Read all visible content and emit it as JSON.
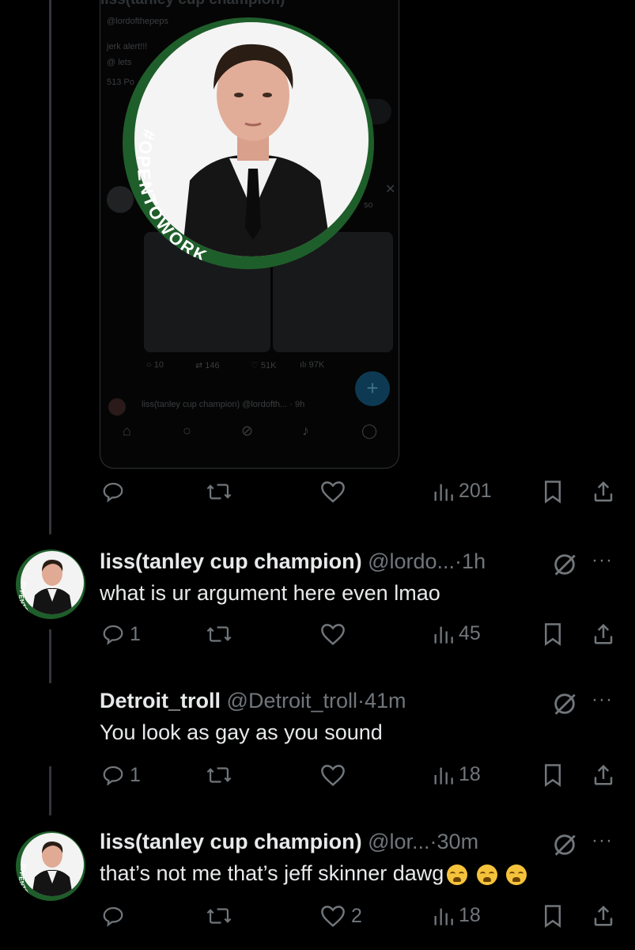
{
  "embedded": {
    "title": "liss(tanley cup champion)",
    "handle": "@lordofthepeps",
    "text": "jerk alert!!!",
    "lets": "@ lets",
    "stat": "513 Po",
    "reply_name": "liss(tanley cup champion)",
    "reply_handle": "@lordofth...",
    "reply_time": "9h",
    "counts": {
      "replies": "10",
      "reposts": "146",
      "likes": "51K",
      "views": "97K"
    },
    "so": "so"
  },
  "badge": {
    "text": "#OPENTOWORK"
  },
  "top_actions": {
    "views": "201"
  },
  "tweets": [
    {
      "name": "liss(tanley cup champion)",
      "handle": "@lordo...",
      "time": "1h",
      "text": "what is ur argument here even lmao",
      "replies": "1",
      "likes": "",
      "views": "45"
    },
    {
      "name": "Detroit_troll",
      "handle": "@Detroit_troll",
      "time": "41m",
      "text": "You look as gay as you sound",
      "replies": "1",
      "likes": "",
      "views": "18"
    },
    {
      "name": "liss(tanley cup champion)",
      "handle": "@lor...",
      "time": "30m",
      "text": "that’s not me that’s jeff skinner dawg",
      "replies": "",
      "likes": "2",
      "views": "18"
    }
  ],
  "more_label": "···",
  "dot": "·",
  "icons": [
    "reply-icon",
    "repost-icon",
    "like-icon",
    "views-icon",
    "bookmark-icon",
    "share-icon",
    "grok-icon",
    "more-icon"
  ],
  "colors": {
    "bg": "#000000",
    "muted": "#71767b",
    "text": "#e7e9ea",
    "otw_green": "#1e5e2a"
  }
}
